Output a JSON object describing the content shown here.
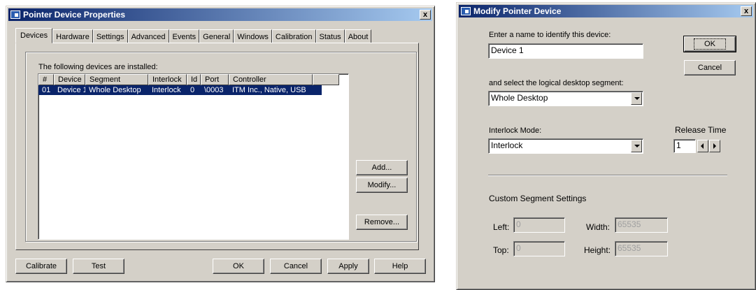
{
  "properties_dialog": {
    "title": "Pointer Device Properties",
    "close_label": "x",
    "tabs": [
      {
        "label": "Devices",
        "active": true
      },
      {
        "label": "Hardware"
      },
      {
        "label": "Settings"
      },
      {
        "label": "Advanced"
      },
      {
        "label": "Events"
      },
      {
        "label": "General"
      },
      {
        "label": "Windows"
      },
      {
        "label": "Calibration"
      },
      {
        "label": "Status"
      },
      {
        "label": "About"
      }
    ],
    "installed_label": "The following devices are installed:",
    "list": {
      "columns": [
        "#",
        "Device",
        "Segment",
        "Interlock",
        "Id",
        "Port",
        "Controller"
      ],
      "rows": [
        {
          "cells": [
            "01",
            "Device 1",
            "Whole Desktop",
            "Interlock",
            "0",
            "\\0003",
            "ITM Inc., Native, USB"
          ],
          "selected": true
        }
      ]
    },
    "buttons": {
      "add": "Add...",
      "modify": "Modify...",
      "remove": "Remove...",
      "calibrate": "Calibrate",
      "test": "Test",
      "ok": "OK",
      "cancel": "Cancel",
      "apply": "Apply",
      "help": "Help"
    }
  },
  "modify_dialog": {
    "title": "Modify Pointer Device",
    "close_label": "x",
    "name_label": "Enter a name to identify this device:",
    "name_value": "Device 1",
    "segment_label": "and select the logical desktop segment:",
    "segment_value": "Whole Desktop",
    "interlock_label": "Interlock Mode:",
    "interlock_value": "Interlock",
    "release_label": "Release Time",
    "release_value": "1",
    "ok": "OK",
    "cancel": "Cancel",
    "custom_heading": "Custom Segment Settings",
    "left_label": "Left:",
    "left_value": "0",
    "width_label": "Width:",
    "width_value": "65535",
    "top_label": "Top:",
    "top_value": "0",
    "height_label": "Height:",
    "height_value": "65535"
  },
  "colors": {
    "face": "#d4d0c8",
    "title_active": "#0a246a",
    "title_gradient_end": "#a6caf0",
    "selection": "#0a246a"
  }
}
